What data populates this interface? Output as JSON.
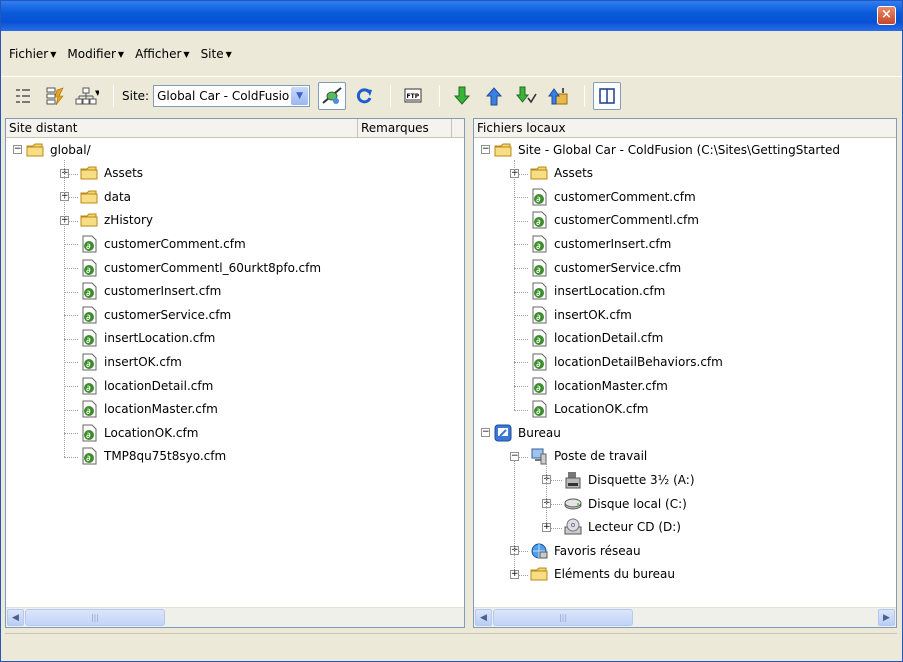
{
  "window": {
    "close_glyph": "×"
  },
  "menu": [
    "Fichier",
    "Modifier",
    "Afficher",
    "Site"
  ],
  "toolbar": {
    "site_label": "Site:",
    "site_value": "Global Car - ColdFusion",
    "icons": [
      "expand-collapse-icon",
      "site-files-icon",
      "site-map-icon",
      "connect-icon",
      "refresh-icon",
      "ftp-log-icon",
      "get-icon",
      "put-icon",
      "check-out-icon",
      "check-in-icon",
      "expand-panel-icon"
    ]
  },
  "left_panel": {
    "headers": [
      "Site distant",
      "Remarques"
    ],
    "root": "global/",
    "folders": [
      "Assets",
      "data",
      "zHistory"
    ],
    "files": [
      "customerComment.cfm",
      "customerCommentl_60urkt8pfo.cfm",
      "customerInsert.cfm",
      "customerService.cfm",
      "insertLocation.cfm",
      "insertOK.cfm",
      "locationDetail.cfm",
      "locationMaster.cfm",
      "LocationOK.cfm",
      "TMP8qu75t8syo.cfm"
    ]
  },
  "right_panel": {
    "headers": [
      "Fichiers locaux"
    ],
    "root": "Site - Global Car - ColdFusion (C:\\Sites\\GettingStarted",
    "folders": [
      "Assets"
    ],
    "files": [
      "customerComment.cfm",
      "customerCommentl.cfm",
      "customerInsert.cfm",
      "customerService.cfm",
      "insertLocation.cfm",
      "insertOK.cfm",
      "locationDetail.cfm",
      "locationDetailBehaviors.cfm",
      "locationMaster.cfm",
      "LocationOK.cfm"
    ],
    "desktop": "Bureau",
    "my_computer": "Poste de travail",
    "drives": [
      "Disquette 3½ (A:)",
      "Disque local (C:)",
      "Lecteur CD (D:)"
    ],
    "network": "Favoris réseau",
    "desktop_items": "Eléments du bureau"
  },
  "colors": {
    "title_blue": "#0a5ad8",
    "chrome": "#ece9d8",
    "folder": "#f2c94c",
    "cfm_green": "#3b8e2a"
  }
}
